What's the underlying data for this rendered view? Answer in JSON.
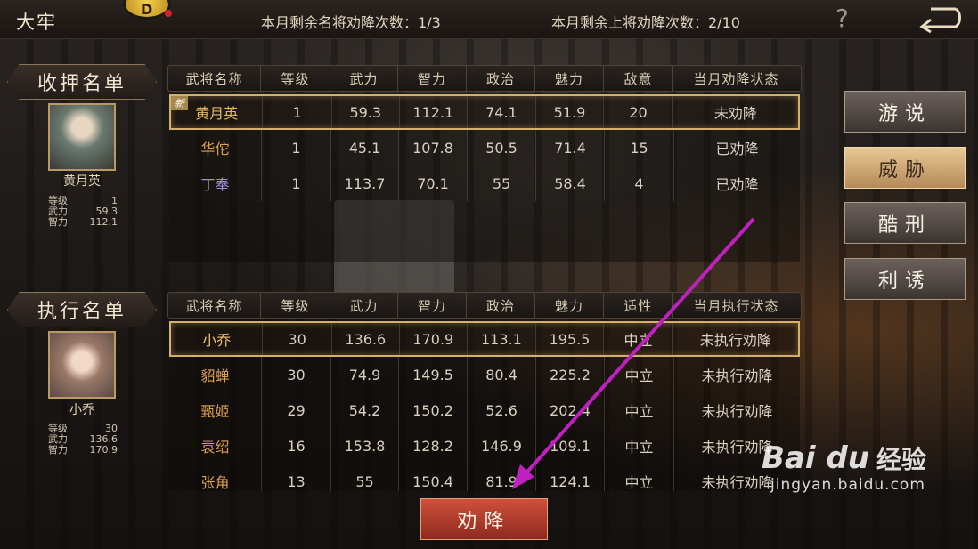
{
  "topbar": {
    "title": "大牢",
    "gem_letter": "D",
    "remaining_famous": "本月剩余名将劝降次数：1/3",
    "remaining_upper": "本月剩余上将劝降次数：2/10",
    "help_label": "?"
  },
  "detained": {
    "section_title": "收押名单",
    "selected": {
      "name": "黄月英",
      "stats": [
        {
          "label": "等级",
          "value": "1"
        },
        {
          "label": "武力",
          "value": "59.3"
        },
        {
          "label": "智力",
          "value": "112.1"
        }
      ]
    },
    "headers": [
      "武将名称",
      "等级",
      "武力",
      "智力",
      "政治",
      "魅力",
      "敌意",
      "当月劝降状态"
    ],
    "rows": [
      {
        "name": "黄月英",
        "level": "1",
        "force": "59.3",
        "intel": "112.1",
        "politics": "74.1",
        "charm": "51.9",
        "hostility": "20",
        "status": "未劝降",
        "tag": "新",
        "name_color": "#e0b860"
      },
      {
        "name": "华佗",
        "level": "1",
        "force": "45.1",
        "intel": "107.8",
        "politics": "50.5",
        "charm": "71.4",
        "hostility": "15",
        "status": "已劝降",
        "name_color": "#e0a050"
      },
      {
        "name": "丁奉",
        "level": "1",
        "force": "113.7",
        "intel": "70.1",
        "politics": "55",
        "charm": "58.4",
        "hostility": "4",
        "status": "已劝降",
        "name_color": "#a08ee0"
      }
    ]
  },
  "execute": {
    "section_title": "执行名单",
    "selected": {
      "name": "小乔",
      "stats": [
        {
          "label": "等级",
          "value": "30"
        },
        {
          "label": "武力",
          "value": "136.6"
        },
        {
          "label": "智力",
          "value": "170.9"
        }
      ]
    },
    "headers": [
      "武将名称",
      "等级",
      "武力",
      "智力",
      "政治",
      "魅力",
      "适性",
      "当月执行状态"
    ],
    "rows": [
      {
        "name": "小乔",
        "level": "30",
        "force": "136.6",
        "intel": "170.9",
        "politics": "113.1",
        "charm": "195.5",
        "aptitude": "中立",
        "status": "未执行劝降",
        "name_color": "#e8c070"
      },
      {
        "name": "貂蝉",
        "level": "30",
        "force": "74.9",
        "intel": "149.5",
        "politics": "80.4",
        "charm": "225.2",
        "aptitude": "中立",
        "status": "未执行劝降",
        "name_color": "#e0a050"
      },
      {
        "name": "甄姬",
        "level": "29",
        "force": "54.2",
        "intel": "150.2",
        "politics": "52.6",
        "charm": "202.4",
        "aptitude": "中立",
        "status": "未执行劝降",
        "name_color": "#e0a050"
      },
      {
        "name": "袁绍",
        "level": "16",
        "force": "153.8",
        "intel": "128.2",
        "politics": "146.9",
        "charm": "109.1",
        "aptitude": "中立",
        "status": "未执行劝降",
        "name_color": "#e0a050"
      },
      {
        "name": "张角",
        "level": "13",
        "force": "55",
        "intel": "150.4",
        "politics": "81.9",
        "charm": "124.1",
        "aptitude": "中立",
        "status": "未执行劝降",
        "name_color": "#e0a050"
      }
    ]
  },
  "actions": [
    "游说",
    "威胁",
    "酷刑",
    "利诱"
  ],
  "active_action": "威胁",
  "surrender_label": "劝降",
  "watermark": {
    "logo": "Bai du",
    "cn": "经验",
    "url": "jingyan.baidu.com"
  },
  "colors": {
    "gold": "#d4b06a",
    "red_button": "#b8402c",
    "arrow": "#c020c0"
  }
}
